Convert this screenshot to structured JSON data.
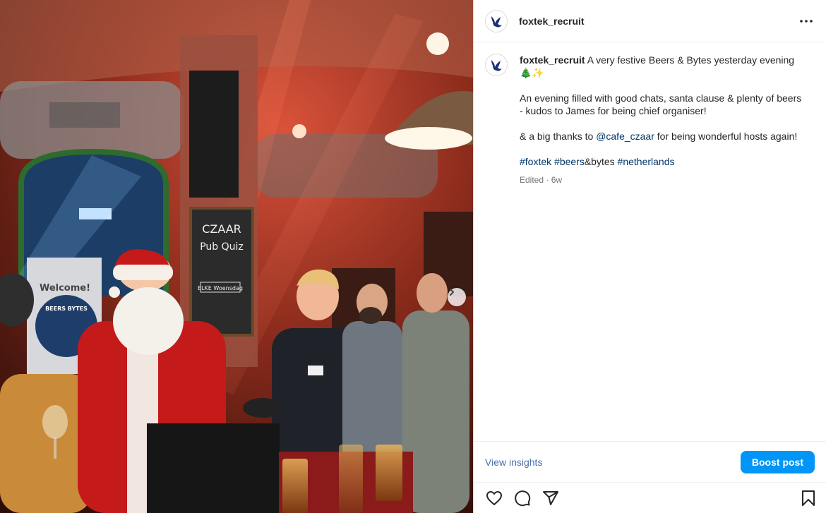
{
  "post": {
    "username": "foxtek_recruit",
    "photo_alt": "",
    "caption": {
      "username": "foxtek_recruit",
      "line1": " A very festive Beers & Bytes yesterday evening ",
      "line1_emoji": "🎄✨",
      "line2": "An evening filled with good chats, santa clause & plenty of beers - kudos to James for being chief organiser!",
      "line3_pre": "& a big thanks to ",
      "line3_mention": "@cafe_czaar",
      "line3_post": " for being wonderful hosts again!",
      "tag1": "#foxtek",
      "tag2": "#beers",
      "tag_text": "&bytes ",
      "tag3": "#netherlands"
    },
    "meta": "Edited · 6w"
  },
  "footer": {
    "view_insights": "View insights",
    "boost": "Boost post"
  },
  "photo_text": {
    "board_title": "CZAAR",
    "board_line2": "Pub Quiz",
    "board_line3": "ELKE Woensdag",
    "banner_welcome": "Welcome!",
    "banner_brand": "BEERS  BYTES"
  },
  "icons": {
    "more": "more-horizontal-icon",
    "heart": "heart-icon",
    "comment": "comment-icon",
    "share": "share-icon",
    "save": "bookmark-icon",
    "next": "chevron-right-icon"
  },
  "colors": {
    "accent": "#0095f6",
    "link": "#00376b"
  }
}
